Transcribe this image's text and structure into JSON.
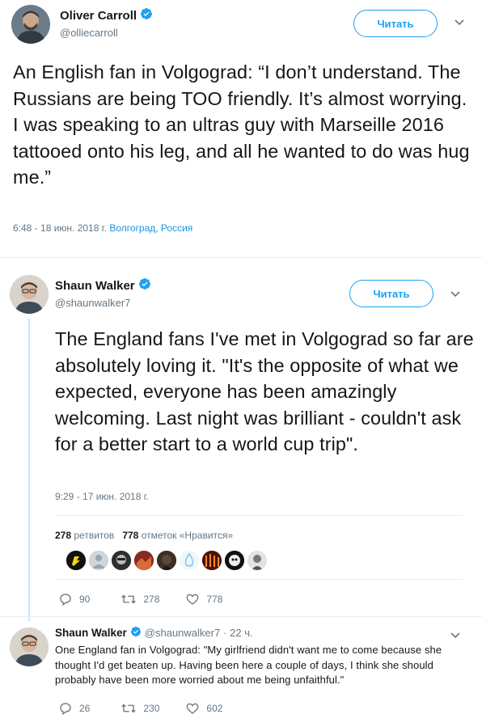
{
  "tweet1": {
    "name": "Oliver Carroll",
    "handle": "@olliecarroll",
    "follow_label": "Читать",
    "text": "An English fan in Volgograd: “I don’t understand. The Russians are being TOO friendly. It’s almost worrying. I was speaking to an ultras guy with Marseille 2016 tattooed onto his leg, and all he wanted to do was hug me.”",
    "time": "6:48 - 18 июн. 2018 г.",
    "location": "Волгоград, Россия"
  },
  "tweet2": {
    "name": "Shaun Walker",
    "handle": "@shaunwalker7",
    "follow_label": "Читать",
    "text": "The England fans I've met in Volgograd so far are absolutely loving it. \"It's the opposite of what we expected, everyone has been amazingly welcoming. Last night was brilliant - couldn't ask for a better start to a world cup trip\".",
    "time": "9:29 - 17 июн. 2018 г.",
    "retweets_count": "278",
    "retweets_label": "ретвитов",
    "likes_count": "778",
    "likes_label": "отметок «Нравится»",
    "replies": "90",
    "retweets": "278",
    "likes": "778"
  },
  "tweet3": {
    "name": "Shaun Walker",
    "handle": "@shaunwalker7",
    "age": "· 22 ч.",
    "text": "One England fan in Volgograd: \"My girlfriend didn't want me to come because she thought I'd get beaten up. Having been here a couple of days, I think she should probably have been more worried about me being unfaithful.\"",
    "replies": "26",
    "retweets": "230",
    "likes": "602"
  },
  "colors": {
    "accent": "#1da1f2",
    "link": "#1b95e0",
    "muted": "#657786",
    "thread": "#cce6fb"
  }
}
